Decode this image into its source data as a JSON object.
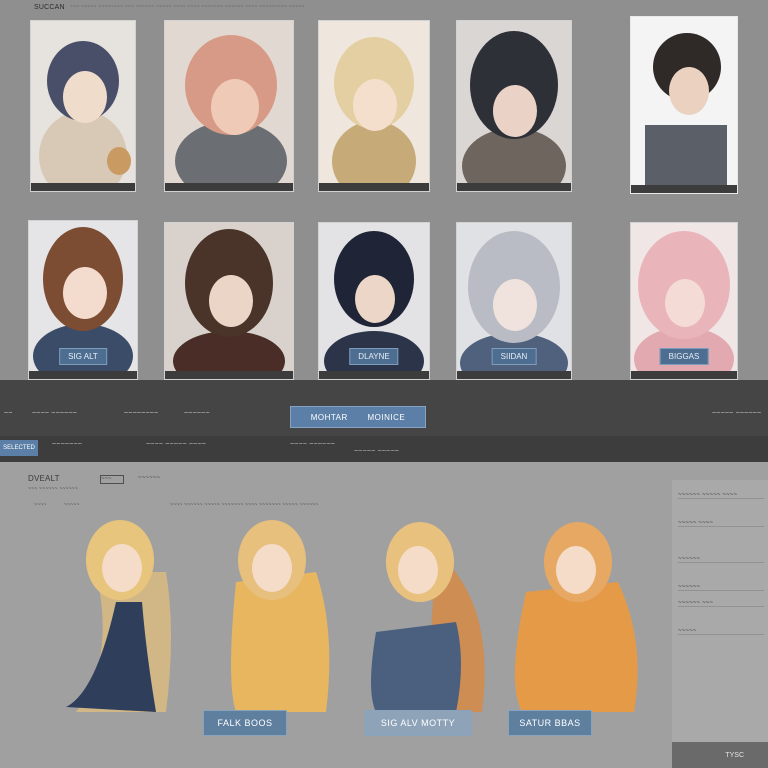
{
  "gallery": {
    "breadcrumb": "SUCCAN",
    "top_caption": "~~~ ~~~~~ ~~~~~~~~ ~~~ ~~~~~~ ~~~~~ ~~~~ ~~~~ ~~~~~~~ ~~~~~~ ~~~~ ~~~~~~~~~ ~~~~~",
    "cards_row1": [
      {
        "label": ""
      },
      {
        "label": ""
      },
      {
        "label": ""
      },
      {
        "label": ""
      },
      {
        "label": ""
      }
    ],
    "cards_row2": [
      {
        "label": "SIG ALT"
      },
      {
        "label": ""
      },
      {
        "label": "DLAYNE"
      },
      {
        "label": "SIIDAN"
      },
      {
        "label": "BIGGAS"
      }
    ]
  },
  "toolbar": {
    "left_labels": [
      "~~",
      "~~~~ ~~~~~~",
      "~~~~~~~~",
      "~~~~~~"
    ],
    "right_label": "~~~~~ ~~~~~~",
    "action_left": "MOHTAR",
    "action_right": "MOINICE"
  },
  "statusbar": {
    "chip": "SELECTED",
    "items": [
      "~~~~~~~",
      "~~~~ ~~~~~ ~~~~",
      "~~~~ ~~~~~~",
      "~~~~~ ~~~~~"
    ]
  },
  "lower": {
    "title": "DVEALT",
    "subtitle": "~~~ ~~~~~~ ~~~~~~",
    "tab_label": "~~~",
    "tab_extra": "~~~~~~",
    "filters": [
      "~~~~",
      "~~~~~",
      "~~~~ ~~~~~~ ~~~~~ ~~~~~~~ ~~~~ ~~~~~~~ ~~~~~ ~~~~~~"
    ],
    "captions": [
      "FALK BOOS",
      "SIG ALV MOTTY",
      "SATUR BBAS"
    ]
  },
  "sidepanel": {
    "rows": [
      "~~~~~~ ~~~~~ ~~~~",
      "~~~~~ ~~~~",
      "~~~~~~",
      "~~~~~~",
      "~~~~~~ ~~~",
      "~~~~~"
    ],
    "bottom": "TYSC"
  },
  "colors": {
    "accent": "#5b7fa6",
    "toolbar": "#454545",
    "gallery_bg": "#8f8f8f",
    "lower_bg": "#a0a0a0"
  }
}
